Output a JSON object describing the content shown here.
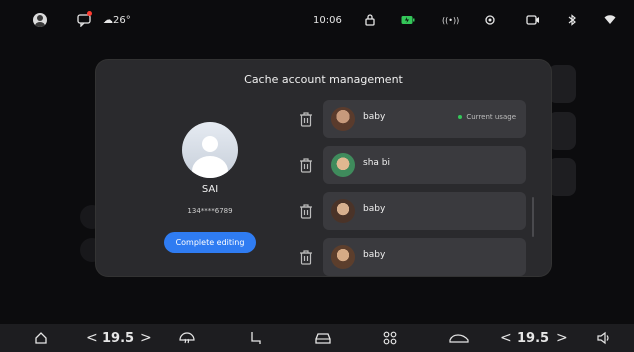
{
  "status_bar": {
    "weather": "☁26°",
    "time": "10:06"
  },
  "modal": {
    "title": "Cache account management",
    "profile": {
      "name": "SAI",
      "phone": "134****6789",
      "button_label": "Complete editing"
    },
    "accounts": [
      {
        "name": "baby",
        "badge": "Current usage",
        "avatar_color": "#8a5a44"
      },
      {
        "name": "sha bi",
        "badge": "",
        "avatar_color": "#4f7a5a"
      },
      {
        "name": "baby",
        "badge": "",
        "avatar_color": "#6a5347"
      },
      {
        "name": "baby",
        "badge": "",
        "avatar_color": "#7a5a3f"
      }
    ]
  },
  "bottom_bar": {
    "left_temp": "19.5",
    "right_temp": "19.5",
    "left_chevron_prev": "<",
    "left_chevron_next": ">",
    "right_chevron_prev": "<",
    "right_chevron_next": ">"
  },
  "colors": {
    "accent": "#2f7cf2",
    "current_usage_dot": "#34c759",
    "notification_dot": "#ff3b30"
  }
}
